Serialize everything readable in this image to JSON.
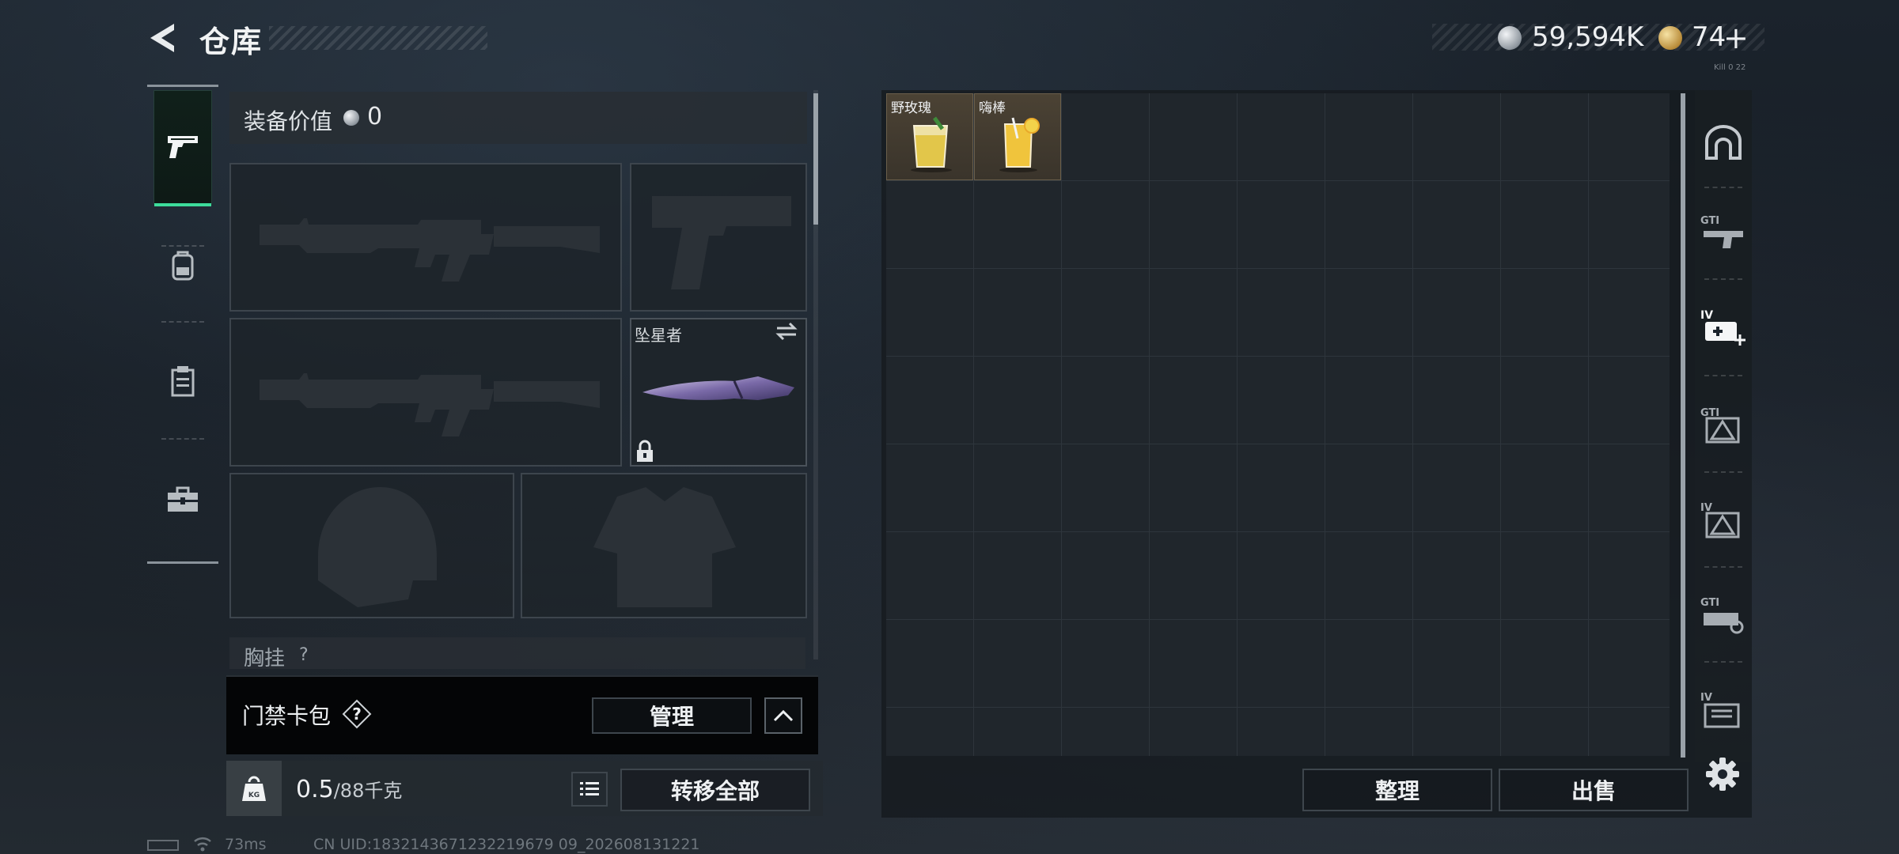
{
  "header": {
    "title": "仓库",
    "silver_amount": "59,594K",
    "gold_amount": "74",
    "plus_label": "+",
    "tiny_note": "Kill 0 22"
  },
  "colors": {
    "accent_green": "#3ddc9b",
    "item_card": "#4b4234",
    "panel": "#20262c"
  },
  "left_rail": {
    "items": [
      {
        "name": "weapons",
        "icon": "pistol-icon",
        "active": true
      },
      {
        "name": "backpack",
        "icon": "backpack-icon",
        "active": false
      },
      {
        "name": "clipboard",
        "icon": "clipboard-icon",
        "active": false
      },
      {
        "name": "toolbox",
        "icon": "toolbox-icon",
        "active": false
      }
    ]
  },
  "equipment": {
    "value_label": "装备价值",
    "value_amount": "0",
    "slots": [
      {
        "slot": "primary-weapon-1",
        "icon": "assault-rifle-icon",
        "filled": false
      },
      {
        "slot": "pistol",
        "icon": "pistol-icon",
        "filled": false
      },
      {
        "slot": "primary-weapon-2",
        "icon": "assault-rifle-icon",
        "filled": false
      },
      {
        "slot": "melee",
        "icon": "knife-icon",
        "filled": true,
        "label": "坠星者",
        "locked": true
      },
      {
        "slot": "helmet",
        "icon": "helmet-icon",
        "filled": false
      },
      {
        "slot": "armor",
        "icon": "armor-vest-icon",
        "filled": false
      }
    ],
    "chest_rig_label": "胸挂",
    "chest_rig_help": "?"
  },
  "keycard": {
    "label": "门禁卡包",
    "help": "?",
    "manage_label": "管理"
  },
  "weight": {
    "icon_text": "KG",
    "current": "0.5",
    "capacity": "/88千克",
    "transfer_all_label": "转移全部"
  },
  "warehouse": {
    "columns": 9,
    "rows": 8,
    "items": [
      {
        "name": "野玫瑰",
        "icon": "cocktail-glass-icon"
      },
      {
        "name": "嗨棒",
        "icon": "highball-glass-icon"
      }
    ],
    "sort_label": "整理",
    "sell_label": "出售"
  },
  "right_rail": {
    "items": [
      {
        "name": "overview",
        "icon": "arch-icon"
      },
      {
        "name": "gti-weapon",
        "icon": "gti-weapon-icon",
        "text": "GTI"
      },
      {
        "name": "iv-medical",
        "icon": "iv-medkit-icon",
        "text": "IV",
        "active": true
      },
      {
        "name": "gti-equipment",
        "icon": "gti-equipment-icon",
        "text": "GTI"
      },
      {
        "name": "iv-equipment",
        "icon": "iv-equipment-icon",
        "text": "IV"
      },
      {
        "name": "gti-attachments",
        "icon": "gti-attachment-icon",
        "text": "GTI"
      },
      {
        "name": "iv-files",
        "icon": "iv-files-icon",
        "text": "IV"
      }
    ]
  },
  "status": {
    "ping": "73ms",
    "uid": "CN UID:1832143671232219679 09_202608131221"
  }
}
